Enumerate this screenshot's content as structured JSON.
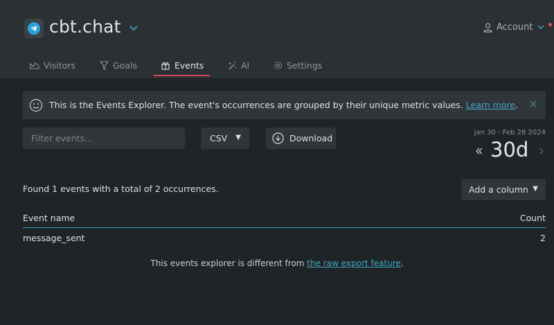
{
  "app": {
    "title": "cbt.chat",
    "account_label": "Account"
  },
  "tabs": [
    {
      "label": "Visitors",
      "icon": "visitors-icon",
      "active": false
    },
    {
      "label": "Goals",
      "icon": "funnel-icon",
      "active": false
    },
    {
      "label": "Events",
      "icon": "events-icon",
      "active": true
    },
    {
      "label": "AI",
      "icon": "magic-wand-icon",
      "active": false
    },
    {
      "label": "Settings",
      "icon": "gear-icon",
      "active": false
    }
  ],
  "banner": {
    "text": "This is the Events Explorer. The event's occurrences are grouped by their unique metric values.",
    "link_text": "Learn more",
    "suffix": "."
  },
  "toolbar": {
    "filter_placeholder": "Filter events...",
    "format_value": "CSV",
    "download_label": "Download"
  },
  "period": {
    "date_range": "Jan 30 - Feb 28 2024",
    "label": "30d"
  },
  "summary": {
    "found_text": "Found 1 events with a total of 2 occurrences.",
    "add_column_label": "Add a column"
  },
  "table": {
    "headers": {
      "name": "Event name",
      "count": "Count"
    },
    "rows": [
      {
        "name": "message_sent",
        "count": "2"
      }
    ]
  },
  "footnote": {
    "prefix": "This events explorer is different from ",
    "link_text": "the raw export feature",
    "suffix": "."
  },
  "colors": {
    "accent": "#3fa8c6",
    "tab_underline": "#d34a57",
    "background": "#1f2426",
    "header_background": "#2b3033"
  }
}
